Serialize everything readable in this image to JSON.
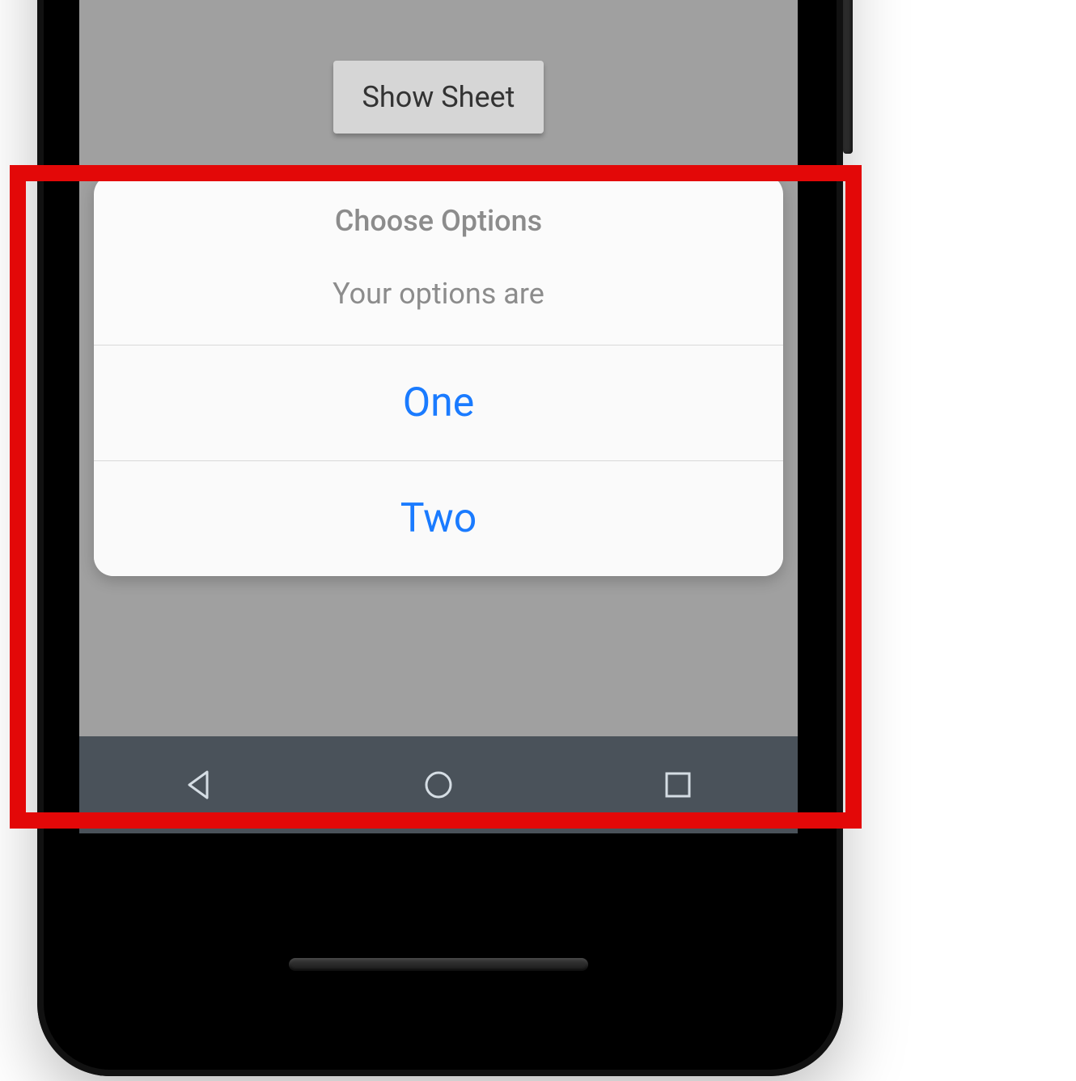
{
  "button": {
    "label": "Show Sheet"
  },
  "sheet": {
    "title": "Choose Options",
    "subtitle": "Your options are",
    "options": [
      "One",
      "Two"
    ]
  },
  "icons": {
    "back": "back-triangle-icon",
    "home": "home-circle-icon",
    "recent": "recent-square-icon"
  }
}
